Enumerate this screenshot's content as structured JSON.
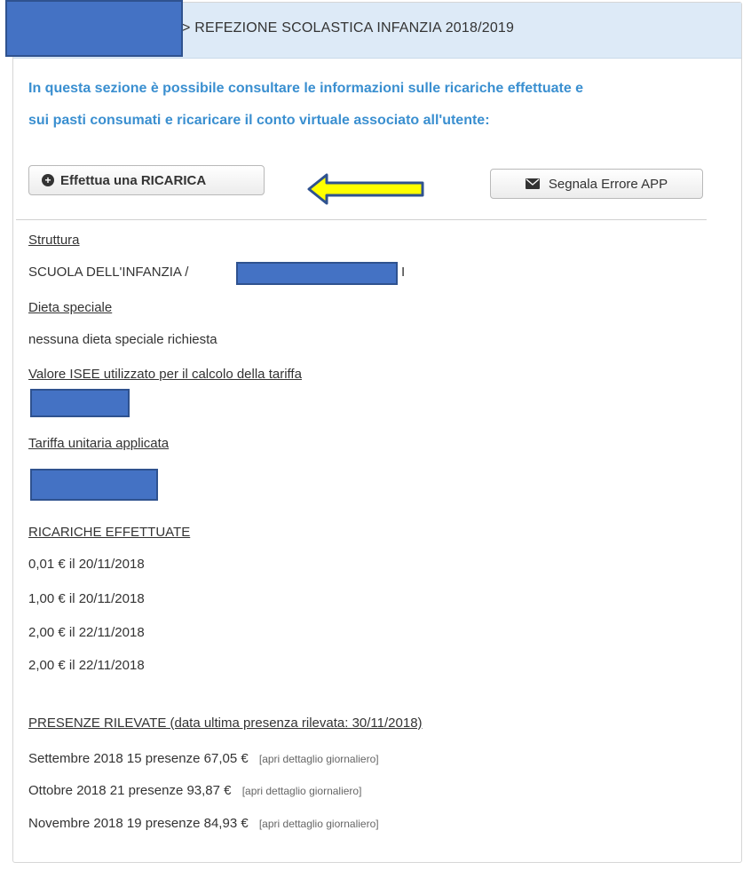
{
  "header": {
    "title": "> REFEZIONE SCOLASTICA INFANZIA 2018/2019"
  },
  "intro": {
    "line1": "In questa sezione è possibile consultare le informazioni sulle ricariche effettuate e",
    "line2": "sui pasti consumati e ricaricare il conto virtuale associato all'utente:"
  },
  "buttons": {
    "recharge_label": "Effettua una RICARICA",
    "report_label": "Segnala Errore APP"
  },
  "colors": {
    "intro_text": "#3a8fd0",
    "header_bg": "#ddeaf7",
    "redaction": "#4472c4",
    "arrow_fill": "#ffff00"
  },
  "details": {
    "structure_label": "Struttura",
    "structure_value": "SCUOLA DELL'INFANZIA /",
    "structure_suffix": "I",
    "diet_label": "Dieta speciale",
    "diet_value": "nessuna dieta speciale richiesta",
    "isee_label": "Valore ISEE utilizzato per il calcolo della tariffa",
    "tariff_label": "Tariffa unitaria applicata"
  },
  "recharges": {
    "title": "RICARICHE EFFETTUATE",
    "items": [
      "0,01 € il 20/11/2018",
      "1,00 € il 20/11/2018",
      "2,00 € il 22/11/2018",
      "2,00 € il 22/11/2018"
    ]
  },
  "attendance": {
    "title": "PRESENZE RILEVATE (data ultima presenza rilevata: 30/11/2018)",
    "link_label": "[apri dettaglio giornaliero]",
    "rows": [
      "Settembre 2018 15 presenze 67,05 €",
      "Ottobre 2018 21 presenze 93,87 €",
      "Novembre 2018 19 presenze 84,93 €"
    ]
  }
}
